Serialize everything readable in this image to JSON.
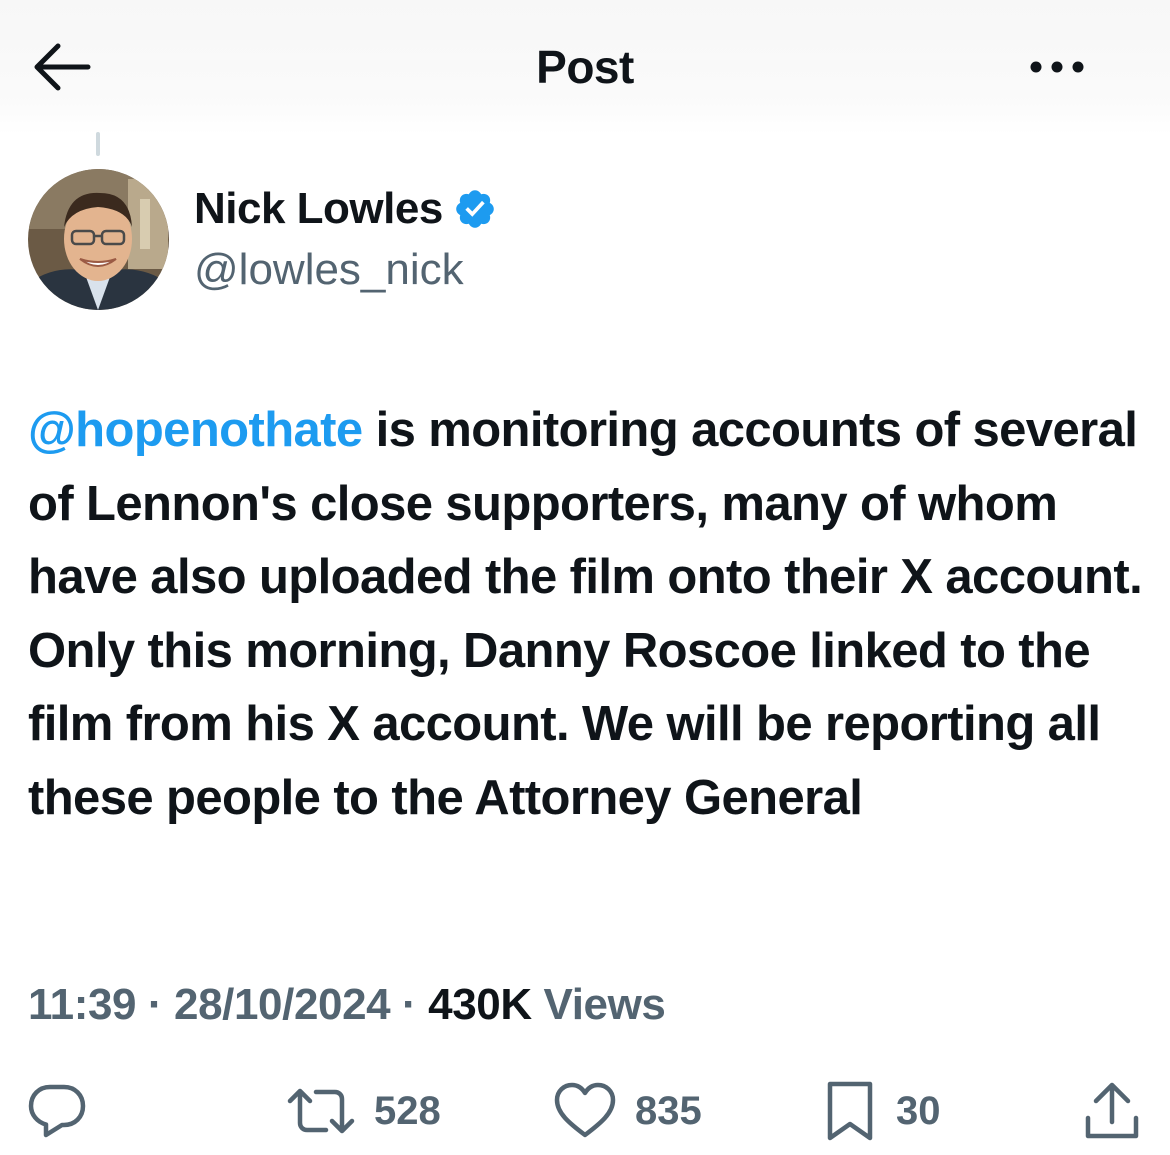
{
  "header": {
    "title": "Post",
    "back_icon": "arrow-left-icon",
    "more_icon": "more-horizontal-icon"
  },
  "author": {
    "name": "Nick Lowles",
    "handle": "@lowles_nick",
    "verified_icon": "verified-badge-icon"
  },
  "tweet": {
    "mention": "@hopenothate",
    "text": " is monitoring accounts of several of Lennon's close supporters, many of whom have also uploaded the film onto their X account. Only this morning, Danny Roscoe linked to the film from his X account. We will be reporting all these people to the Attorney General"
  },
  "meta": {
    "time": "11:39",
    "date": "28/10/2024",
    "separator": " · ",
    "views_count": "430K",
    "views_label": " Views"
  },
  "actions": {
    "reply": {
      "icon": "reply-icon"
    },
    "repost": {
      "icon": "repost-icon",
      "count": "528"
    },
    "like": {
      "icon": "heart-icon",
      "count": "835"
    },
    "bookmark": {
      "icon": "bookmark-icon",
      "count": "30"
    },
    "share": {
      "icon": "share-icon"
    }
  },
  "colors": {
    "accent": "#1d9bf0",
    "text": "#0f1419",
    "secondary": "#536471"
  }
}
